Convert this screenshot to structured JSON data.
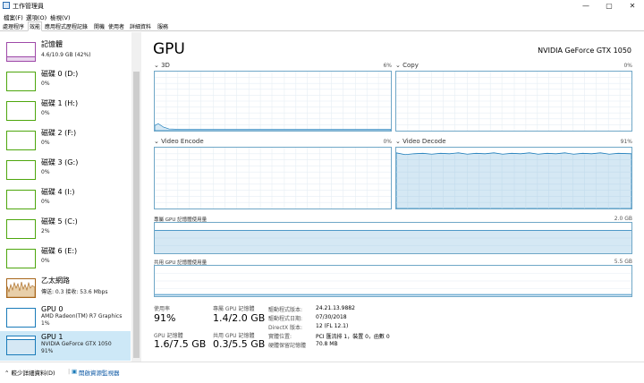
{
  "window": {
    "title": "工作管理員",
    "minimize": "—",
    "maximize": "▢",
    "close": "✕"
  },
  "menu": [
    "檔案(F)",
    "選項(O)",
    "檢視(V)"
  ],
  "tabs": [
    "處理程序",
    "效能",
    "應用程式歷程記錄",
    "開機",
    "使用者",
    "詳細資料",
    "服務"
  ],
  "active_tab_index": 1,
  "sidebar": {
    "items": [
      {
        "title": "記憶體",
        "sub1": "4.6/10.9 GB (42%)",
        "sub2": "",
        "color": "#9e49a8"
      },
      {
        "title": "磁碟 0 (D:)",
        "sub1": "0%",
        "sub2": "",
        "color": "#4da60c"
      },
      {
        "title": "磁碟 1 (H:)",
        "sub1": "0%",
        "sub2": "",
        "color": "#4da60c"
      },
      {
        "title": "磁碟 2 (F:)",
        "sub1": "0%",
        "sub2": "",
        "color": "#4da60c"
      },
      {
        "title": "磁碟 3 (G:)",
        "sub1": "0%",
        "sub2": "",
        "color": "#4da60c"
      },
      {
        "title": "磁碟 4 (I:)",
        "sub1": "0%",
        "sub2": "",
        "color": "#4da60c"
      },
      {
        "title": "磁碟 5 (C:)",
        "sub1": "2%",
        "sub2": "",
        "color": "#4da60c"
      },
      {
        "title": "磁碟 6 (E:)",
        "sub1": "0%",
        "sub2": "",
        "color": "#4da60c"
      },
      {
        "title": "乙太網路",
        "sub1": "傳送: 0.3  接收: 53.6 Mbps",
        "sub2": "",
        "color": "#a7651a"
      },
      {
        "title": "GPU 0",
        "sub1": "AMD Radeon(TM) R7 Graphics",
        "sub2": "1%",
        "color": "#1a7bb9"
      },
      {
        "title": "GPU 1",
        "sub1": "NVIDIA GeForce GTX 1050",
        "sub2": "91%",
        "color": "#1a7bb9"
      }
    ],
    "selected_index": 10
  },
  "main": {
    "title": "GPU",
    "gpu_name": "NVIDIA GeForce GTX 1050",
    "engines": [
      {
        "label": "3D",
        "pct": "6%"
      },
      {
        "label": "Copy",
        "pct": "0%"
      },
      {
        "label": "Video Encode",
        "pct": "0%"
      },
      {
        "label": "Video Decode",
        "pct": "91%"
      }
    ],
    "dedicated": {
      "label": "專屬 GPU 記憶體使用量",
      "max": "2.0 GB"
    },
    "shared": {
      "label": "共用 GPU 記憶體使用量",
      "max": "5.5 GB"
    },
    "stats": {
      "usage_label": "使用率",
      "usage_value": "91%",
      "dedicated_label": "專屬 GPU 記憶體",
      "dedicated_value": "1.4/2.0 GB",
      "gpu_mem_label": "GPU 記憶體",
      "gpu_mem_value": "1.6/7.5 GB",
      "shared_label": "共用 GPU 記憶體",
      "shared_value": "0.3/5.5 GB"
    },
    "info": [
      {
        "label": "驅動程式版本:",
        "value": "24.21.13.9882"
      },
      {
        "label": "驅動程式日期:",
        "value": "07/30/2018"
      },
      {
        "label": "DirectX 版本:",
        "value": "12 (FL 12.1)"
      },
      {
        "label": "實體位置:",
        "value": "PCI 匯流排 1，裝置 0，函數 0"
      },
      {
        "label": "硬體保留記憶體",
        "value": "70.8 MB"
      }
    ]
  },
  "footer": {
    "fewer_details": "較少詳細資料(D)",
    "resource_monitor": "開啟資源監視器"
  },
  "colors": {
    "accent": "#1a7bb9",
    "graph_border": "#6fa7c7",
    "selected": "#cde8f7"
  }
}
